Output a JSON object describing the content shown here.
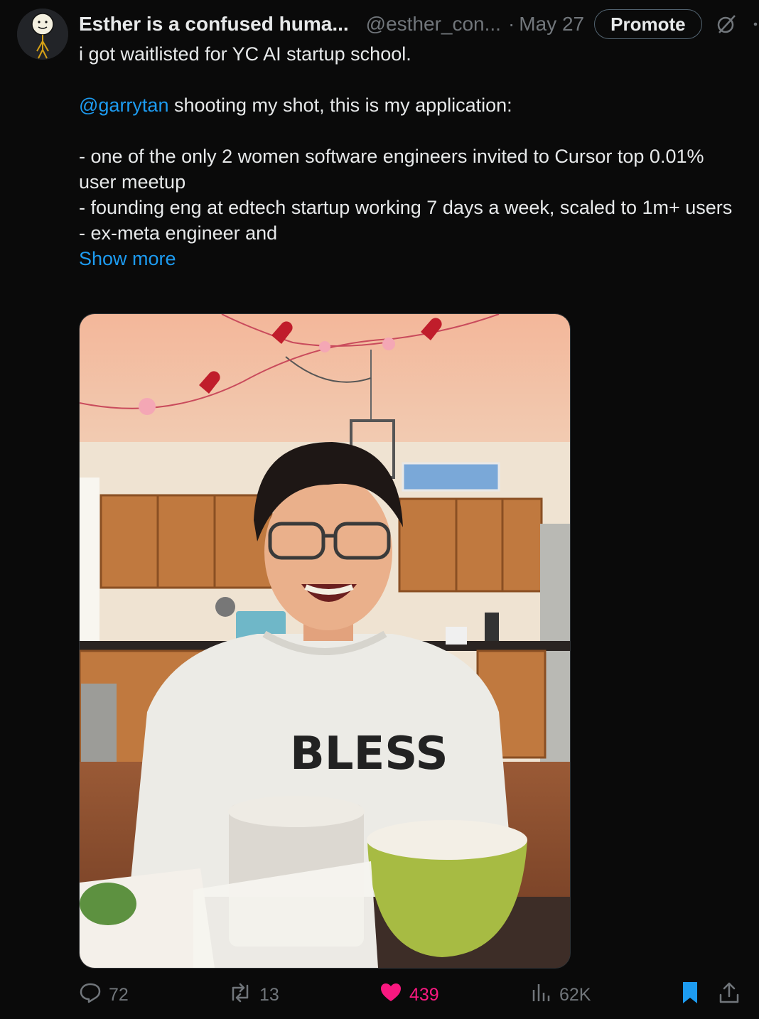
{
  "tweet": {
    "author_name": "Esther is a confused huma...",
    "author_handle": "@esther_con...",
    "dot": "·",
    "date": "May 27",
    "promote_label": "Promote",
    "line1": "i got waitlisted for YC AI startup school.",
    "mention": "@garrytan",
    "line2_rest": " shooting my shot, this is my application:",
    "bullet1": "- one of the only 2 women software engineers invited to Cursor top 0.01% user meetup",
    "bullet2": "- founding eng at edtech startup working 7 days a week, scaled to 1m+ users",
    "bullet3": "- ex-meta engineer and",
    "show_more": "Show more",
    "sweatshirt_text": "BLESS"
  },
  "actions": {
    "replies": "72",
    "reposts": "13",
    "likes": "439",
    "views": "62K"
  },
  "colors": {
    "accent": "#1d9bf0",
    "like": "#f91880",
    "muted": "#71767b",
    "background": "#0a0a0a"
  },
  "icons": [
    "reply-icon",
    "repost-icon",
    "heart-icon",
    "views-icon",
    "bookmark-icon",
    "share-icon",
    "grok-icon",
    "more-icon"
  ]
}
